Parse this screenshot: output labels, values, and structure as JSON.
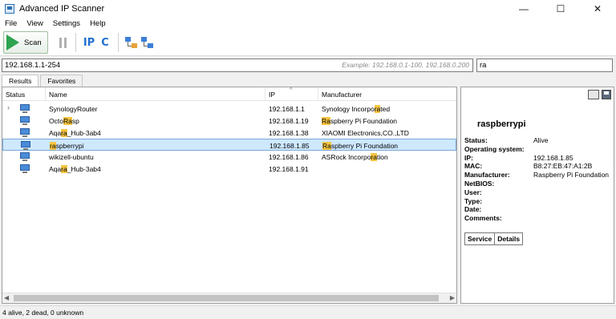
{
  "window": {
    "title": "Advanced IP Scanner",
    "controls": {
      "minimize": "—",
      "maximize": "☐",
      "close": "✕"
    }
  },
  "menu": [
    "File",
    "View",
    "Settings",
    "Help"
  ],
  "toolbar": {
    "scan_label": "Scan",
    "ip_label": "IP",
    "c_label": "C"
  },
  "address": {
    "range_value": "192.168.1.1-254",
    "range_example": "Example: 192.168.0.1-100, 192.168.0.200",
    "search_value": "ra"
  },
  "tabs": {
    "results": "Results",
    "favorites": "Favorites"
  },
  "table": {
    "columns": [
      "Status",
      "Name",
      "IP",
      "Manufacturer"
    ],
    "sort_indicator": "^",
    "rows": [
      {
        "name": "SynologyRouter",
        "ip": "192.168.1.1",
        "manufacturer": "Synology Incorporated",
        "expander": "›",
        "selected": false
      },
      {
        "name": "OctoRasp",
        "ip": "192.168.1.19",
        "manufacturer": "Raspberry Pi Foundation",
        "expander": "",
        "selected": false
      },
      {
        "name": "Aqara_Hub-3ab4",
        "ip": "192.168.1.38",
        "manufacturer": "XIAOMI Electronics,CO.,LTD",
        "expander": "",
        "selected": false
      },
      {
        "name": "raspberrypi",
        "ip": "192.168.1.85",
        "manufacturer": "Raspberry Pi Foundation",
        "expander": "",
        "selected": true
      },
      {
        "name": "wikizell-ubuntu",
        "ip": "192.168.1.86",
        "manufacturer": "ASRock Incorporation",
        "expander": "",
        "selected": false
      },
      {
        "name": "Aqara_Hub-3ab4",
        "ip": "192.168.1.91",
        "manufacturer": "",
        "expander": "",
        "selected": false
      }
    ],
    "scroll_left": "◀",
    "scroll_right": "▶"
  },
  "details": {
    "device_name": "raspberrypi",
    "fields": [
      {
        "label": "Status:",
        "value": "Alive"
      },
      {
        "label": "Operating system:",
        "value": ""
      },
      {
        "label": "IP:",
        "value": "192.168.1.85"
      },
      {
        "label": "MAC:",
        "value": "B8:27:EB:47:A1:2B"
      },
      {
        "label": "Manufacturer:",
        "value": "Raspberry Pi Foundation"
      },
      {
        "label": "NetBIOS:",
        "value": ""
      },
      {
        "label": "User:",
        "value": ""
      },
      {
        "label": "Type:",
        "value": ""
      },
      {
        "label": "Date:",
        "value": ""
      },
      {
        "label": "Comments:",
        "value": ""
      }
    ],
    "tab_service": "Service",
    "tab_details": "Details"
  },
  "status_bar": "4 alive, 2 dead, 0 unknown",
  "colors": {
    "highlight": "#f5c542",
    "selected_row": "#cde8ff",
    "scan_green": "#2ea44f"
  }
}
